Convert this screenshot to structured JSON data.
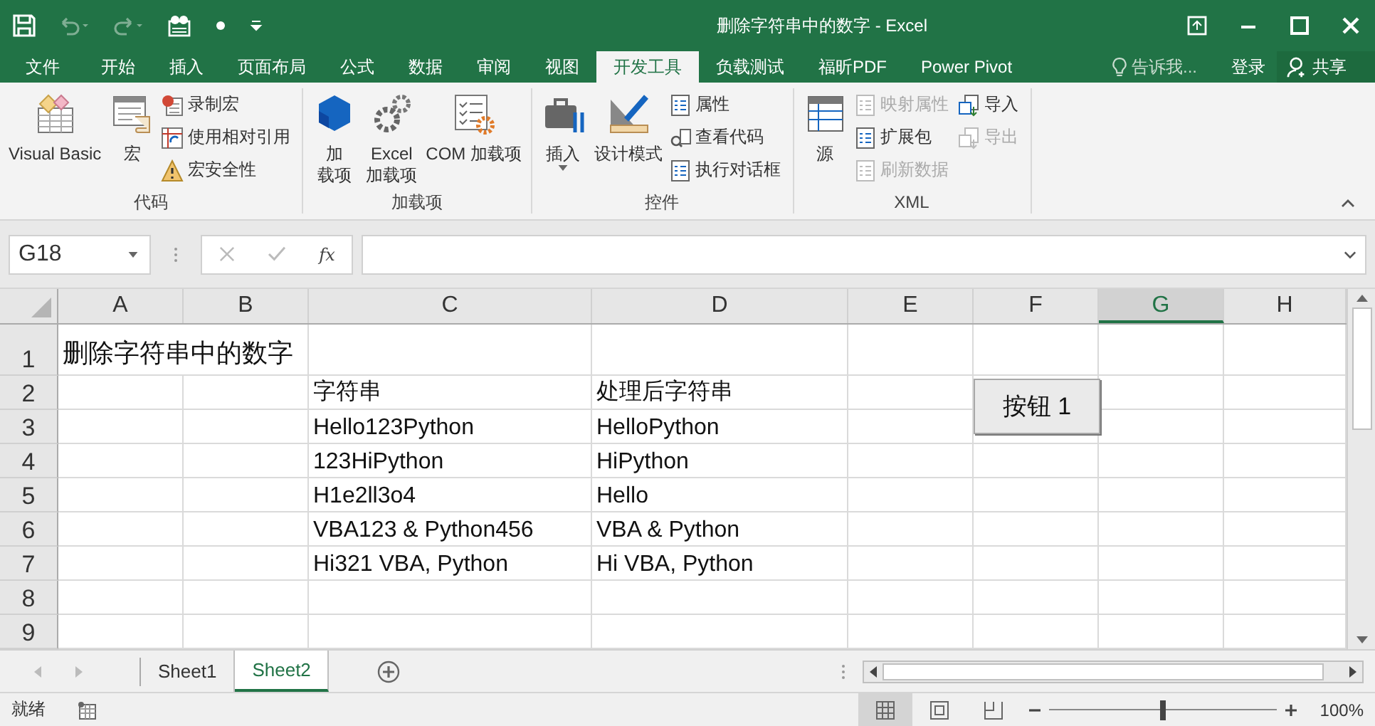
{
  "window": {
    "title": "删除字符串中的数字 - Excel"
  },
  "tabs": [
    {
      "label": "文件",
      "selected": false
    },
    {
      "label": "开始",
      "selected": false
    },
    {
      "label": "插入",
      "selected": false
    },
    {
      "label": "页面布局",
      "selected": false
    },
    {
      "label": "公式",
      "selected": false
    },
    {
      "label": "数据",
      "selected": false
    },
    {
      "label": "审阅",
      "selected": false
    },
    {
      "label": "视图",
      "selected": false
    },
    {
      "label": "开发工具",
      "selected": true
    },
    {
      "label": "负载测试",
      "selected": false
    },
    {
      "label": "福昕PDF",
      "selected": false
    },
    {
      "label": "Power Pivot",
      "selected": false
    }
  ],
  "tell_me": {
    "placeholder": "告诉我..."
  },
  "sign_in": "登录",
  "share": "共享",
  "ribbon": [
    {
      "label": "代码",
      "columns": [
        [
          {
            "kind": "large",
            "lines": [
              "Visual Basic"
            ],
            "disabled": false
          }
        ],
        [
          {
            "kind": "large",
            "lines": [
              "宏"
            ],
            "disabled": false
          }
        ],
        [
          {
            "kind": "small",
            "lines": [
              "录制宏"
            ],
            "disabled": false
          },
          {
            "kind": "small",
            "lines": [
              "使用相对引用"
            ],
            "disabled": false
          },
          {
            "kind": "small",
            "lines": [
              "宏安全性"
            ],
            "disabled": false
          }
        ]
      ]
    },
    {
      "label": "加载项",
      "columns": [
        [
          {
            "kind": "large",
            "lines": [
              "加",
              "载项"
            ],
            "disabled": false
          }
        ],
        [
          {
            "kind": "large",
            "lines": [
              "Excel",
              "加载项"
            ],
            "disabled": false
          }
        ],
        [
          {
            "kind": "large",
            "lines": [
              "COM 加载项"
            ],
            "disabled": false
          }
        ]
      ]
    },
    {
      "label": "控件",
      "columns": [
        [
          {
            "kind": "large",
            "lines": [
              "插入"
            ],
            "disabled": false,
            "dropdown": true
          }
        ],
        [
          {
            "kind": "large",
            "lines": [
              "设计模式"
            ],
            "disabled": false
          }
        ],
        [
          {
            "kind": "small",
            "lines": [
              "属性"
            ],
            "disabled": false
          },
          {
            "kind": "small",
            "lines": [
              "查看代码"
            ],
            "disabled": false
          },
          {
            "kind": "small",
            "lines": [
              "执行对话框"
            ],
            "disabled": false
          }
        ]
      ]
    },
    {
      "label": "XML",
      "columns": [
        [
          {
            "kind": "large",
            "lines": [
              "源"
            ],
            "disabled": false
          }
        ],
        [
          {
            "kind": "small",
            "lines": [
              "映射属性"
            ],
            "disabled": true
          },
          {
            "kind": "small",
            "lines": [
              "扩展包"
            ],
            "disabled": false
          },
          {
            "kind": "small",
            "lines": [
              "刷新数据"
            ],
            "disabled": true
          }
        ],
        [
          {
            "kind": "small",
            "lines": [
              "导入"
            ],
            "disabled": false
          },
          {
            "kind": "small",
            "lines": [
              "导出"
            ],
            "disabled": true
          }
        ]
      ]
    }
  ],
  "name_box": "G18",
  "function_label": "fx",
  "columns": [
    {
      "label": "A",
      "selected": false
    },
    {
      "label": "B",
      "selected": false
    },
    {
      "label": "C",
      "selected": false
    },
    {
      "label": "D",
      "selected": false
    },
    {
      "label": "E",
      "selected": false
    },
    {
      "label": "F",
      "selected": false
    },
    {
      "label": "G",
      "selected": true
    },
    {
      "label": "H",
      "selected": false
    }
  ],
  "rows": [
    {
      "number": "1",
      "kind": "title",
      "cells": {
        "A": "删除字符串中的数字"
      }
    },
    {
      "number": "2",
      "kind": "normal",
      "cells": {
        "C": "字符串",
        "D": "处理后字符串"
      }
    },
    {
      "number": "3",
      "kind": "normal",
      "cells": {
        "C": "Hello123Python",
        "D": "HelloPython"
      }
    },
    {
      "number": "4",
      "kind": "normal",
      "cells": {
        "C": "123HiPython",
        "D": "HiPython"
      }
    },
    {
      "number": "5",
      "kind": "normal",
      "cells": {
        "C": "H1e2ll3o4",
        "D": "Hello"
      }
    },
    {
      "number": "6",
      "kind": "normal",
      "cells": {
        "C": "VBA123 & Python456",
        "D": "VBA & Python"
      }
    },
    {
      "number": "7",
      "kind": "normal",
      "cells": {
        "C": "Hi321 VBA, Python",
        "D": "Hi VBA, Python"
      }
    },
    {
      "number": "8",
      "kind": "normal",
      "cells": {}
    },
    {
      "number": "9",
      "kind": "normal",
      "cells": {}
    }
  ],
  "form_button": {
    "label": "按钮 1"
  },
  "sheets": [
    {
      "label": "Sheet1",
      "selected": false
    },
    {
      "label": "Sheet2",
      "selected": true
    }
  ],
  "status": {
    "text": "就绪",
    "views": [
      {
        "selected": true
      },
      {
        "selected": false
      },
      {
        "selected": false
      }
    ],
    "zoom": {
      "level": 0.5,
      "reading": "100%"
    }
  }
}
